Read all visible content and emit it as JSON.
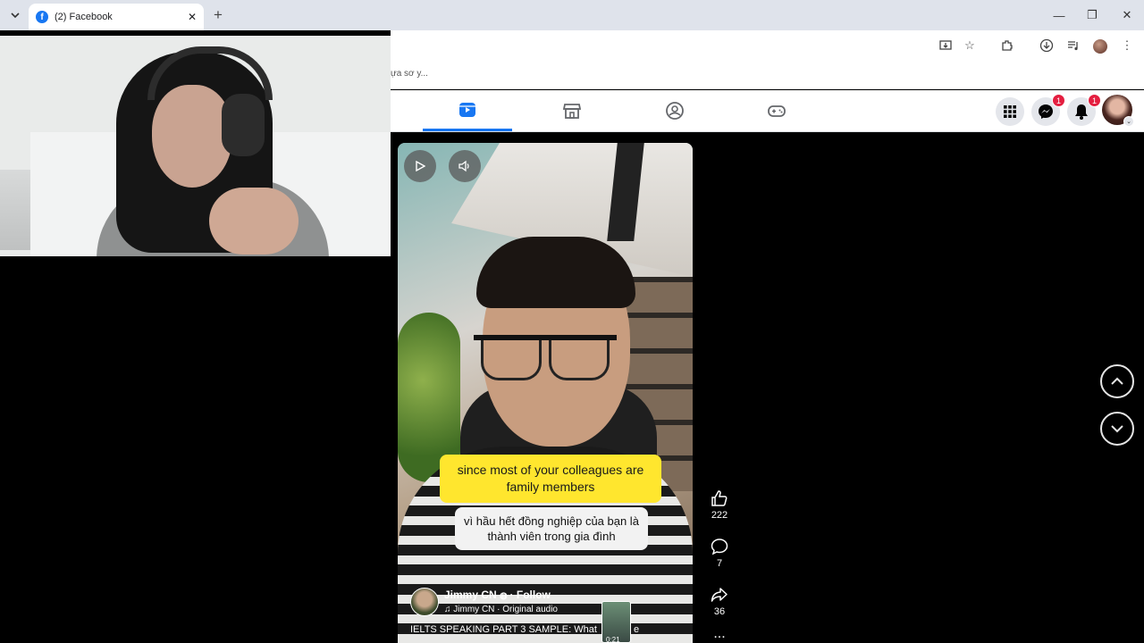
{
  "browser": {
    "tab_title": "(2) Facebook",
    "new_tab_symbol": "+",
    "close_tab_symbol": "✕",
    "window_controls": {
      "minimize": "—",
      "maximize": "❐",
      "close": "✕"
    },
    "toolbar_icons": [
      "install-icon",
      "bookmark-star-icon",
      "extensions-icon",
      "download-icon",
      "media-control-icon",
      "profile-avatar",
      "kebab-menu-icon"
    ]
  },
  "bookmarks": {
    "text": "ựa sơ y..."
  },
  "fb_nav": {
    "tabs": [
      "reels-tab",
      "marketplace-tab",
      "groups-tab",
      "gaming-tab"
    ],
    "active_tab": "reels-tab",
    "messenger_badge": "1",
    "notifications_badge": "1",
    "accent_color": "#1877f2",
    "badge_color": "#e41e3f"
  },
  "reel": {
    "caption_en": "since most of your colleagues are family members",
    "caption_vi": "vì hầu hết đồng nghiệp của bạn là thành viên trong gia đình",
    "author_name": "Jimmy CN",
    "follow_label": "· Follow",
    "audio_label": "Jimmy CN · Original audio",
    "description": "IELTS SPEAKING PART 3 SAMPLE: What",
    "description_tail": "e",
    "thumb_time": "0:21",
    "caption_bg": "#ffe62e"
  },
  "actions": {
    "likes": "222",
    "comments": "7",
    "shares": "36",
    "more": "..."
  }
}
